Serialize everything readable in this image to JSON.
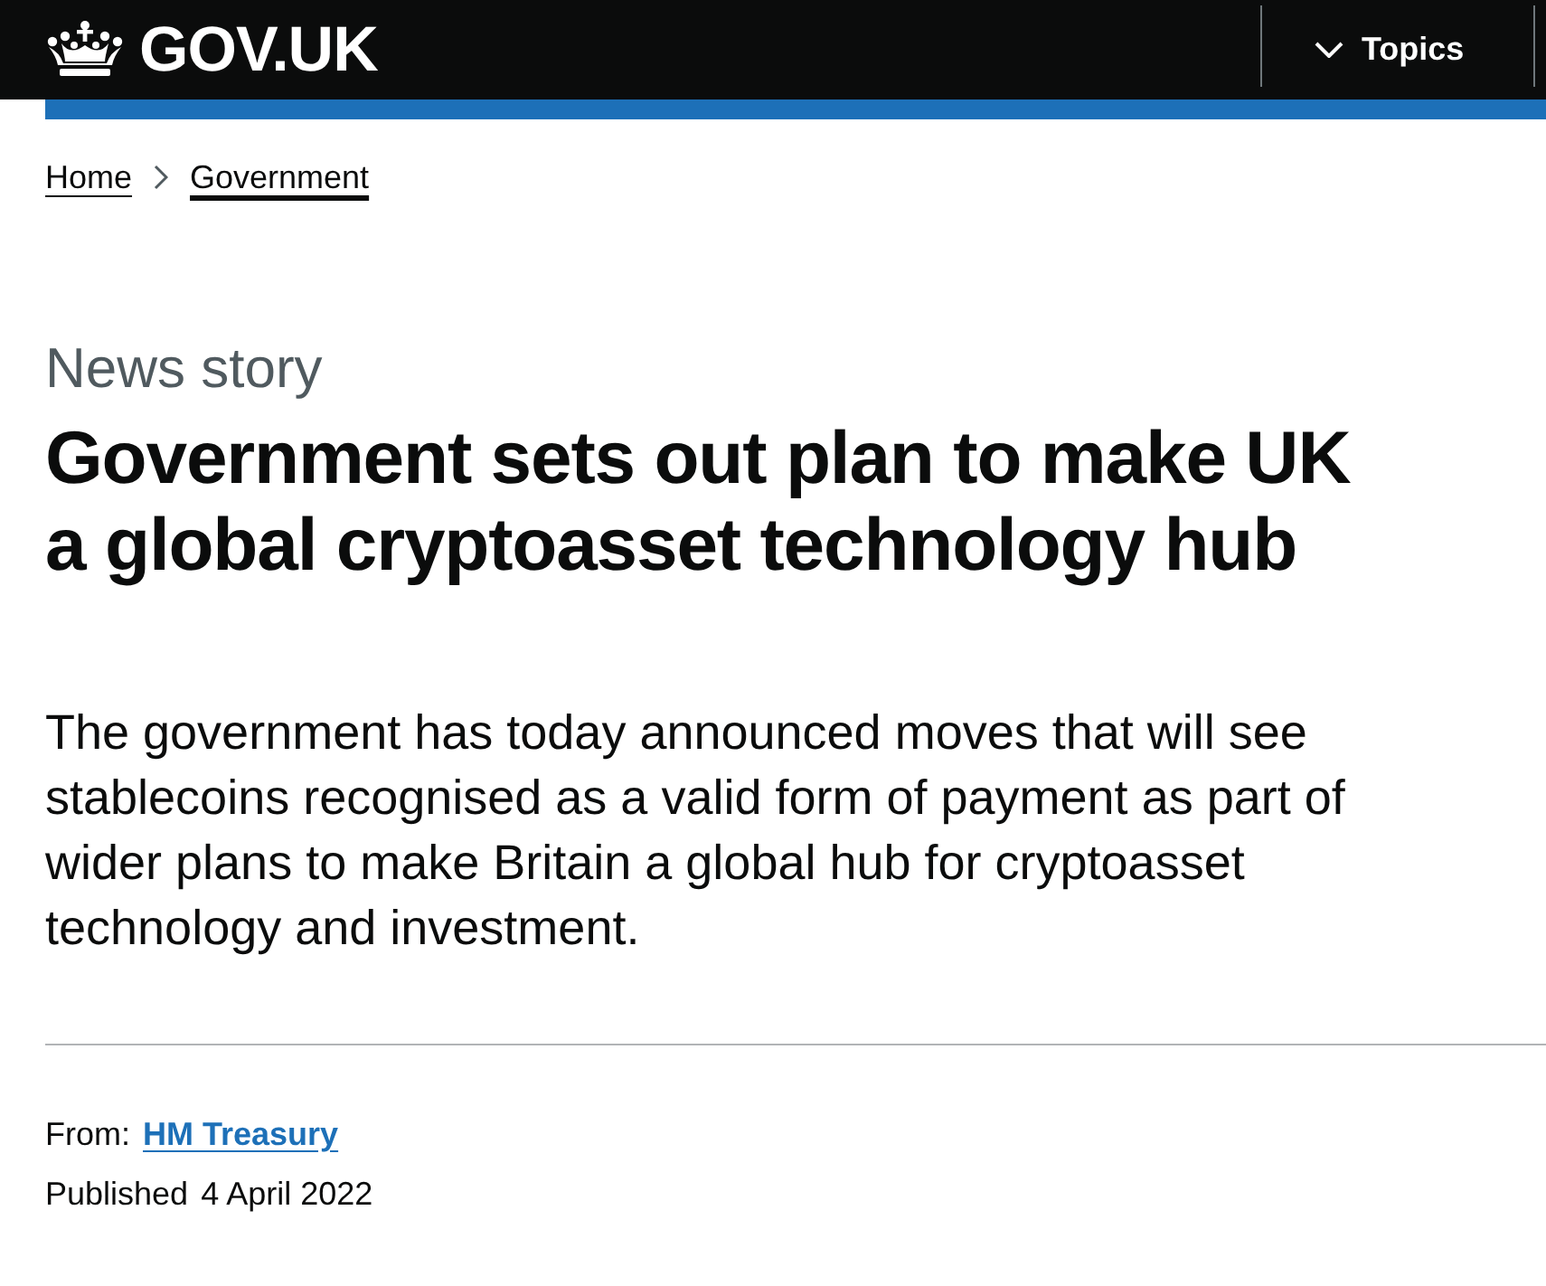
{
  "header": {
    "logo_text": "GOV.UK",
    "menu": {
      "label": "Topics",
      "expanded": false
    }
  },
  "breadcrumbs": [
    {
      "label": "Home",
      "hovered": false
    },
    {
      "label": "Government",
      "hovered": true
    }
  ],
  "article": {
    "type_label": "News story",
    "title": "Government sets out plan to make UK a global cryptoasset technology hub",
    "lead": "The government has today announced moves that will see stablecoins recognised as a valid form of payment as part of wider plans to make Britain a global hub for cryptoasset technology and investment."
  },
  "metadata": {
    "from_label": "From:",
    "from_link": "HM Treasury",
    "published_label": "Published",
    "published_date": "4 April 2022"
  }
}
